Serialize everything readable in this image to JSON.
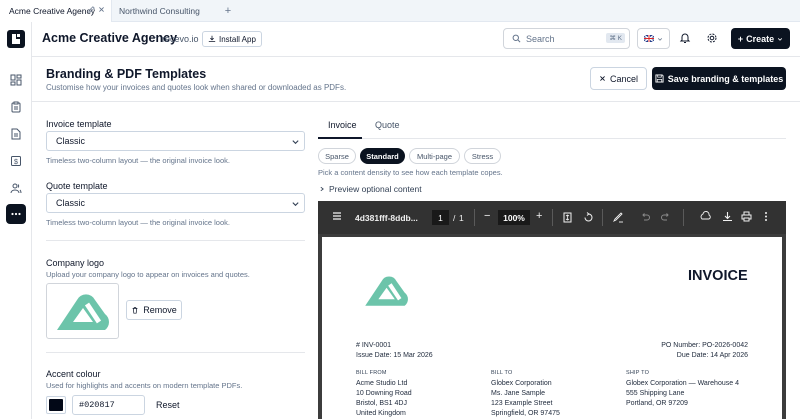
{
  "browser_tabs": [
    {
      "label": "Acme Creative Agency",
      "active": true
    },
    {
      "label": "Northwind Consulting",
      "active": false
    }
  ],
  "topbar": {
    "brand": "Acme Creative Agency",
    "separator": "·",
    "domain": "recevo.io",
    "install_label": "Install App",
    "search_placeholder": "Search",
    "search_shortcut": "⌘ K",
    "create_label": "Create"
  },
  "page": {
    "title": "Branding & PDF Templates",
    "subtitle": "Customise how your invoices and quotes look when shared or downloaded as PDFs.",
    "cancel_label": "Cancel",
    "save_label": "Save branding & templates"
  },
  "form": {
    "invoice_template": {
      "label": "Invoice template",
      "value": "Classic",
      "help": "Timeless two-column layout — the original invoice look."
    },
    "quote_template": {
      "label": "Quote template",
      "value": "Classic",
      "help": "Timeless two-column layout — the original invoice look."
    },
    "company_logo": {
      "label": "Company logo",
      "help": "Upload your company logo to appear on invoices and quotes.",
      "remove_label": "Remove"
    },
    "accent_colour": {
      "label": "Accent colour",
      "help": "Used for highlights and accents on modern template PDFs.",
      "value": "#020817",
      "reset_label": "Reset"
    }
  },
  "preview": {
    "tabs": [
      "Invoice",
      "Quote"
    ],
    "densities": [
      "Sparse",
      "Standard",
      "Multi-page",
      "Stress"
    ],
    "active_density": "Standard",
    "density_help": "Pick a content density to see how each template copes.",
    "optional_toggle": "Preview optional content"
  },
  "viewer": {
    "file_name": "4d381fff-8ddb...",
    "current_page": "1",
    "page_sep": "/",
    "total_pages": "1",
    "zoom": "100%"
  },
  "invoice": {
    "title": "INVOICE",
    "number": "# INV-0001",
    "issue_date": "Issue Date: 15 Mar 2026",
    "po_number": "PO Number: PO-2026-0042",
    "due_date": "Due Date: 14 Apr 2026",
    "bill_from": {
      "heading": "BILL FROM",
      "lines": [
        "Acme Studio Ltd",
        "10 Downing Road",
        "Bristol, BS1 4DJ",
        "United Kingdom"
      ]
    },
    "bill_to": {
      "heading": "BILL TO",
      "lines": [
        "Globex Corporation",
        "Ms. Jane Sample",
        "123 Example Street",
        "Springfield, OR 97475"
      ]
    },
    "ship_to": {
      "heading": "SHIP TO",
      "lines": [
        "Globex Corporation — Warehouse 4",
        "555 Shipping Lane",
        "Portland, OR 97209"
      ]
    }
  },
  "colors": {
    "accent": "#020817",
    "logo_teal": "#6cc4aa",
    "dark": "#0b1320"
  }
}
